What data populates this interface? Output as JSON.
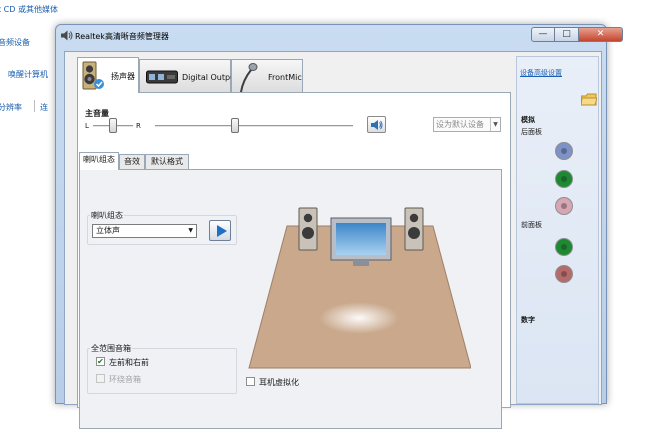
{
  "background": {
    "items": [
      "t CD 或其他媒体",
      "音频设备",
      "唤醒计算机",
      "分辨率",
      "连"
    ]
  },
  "window": {
    "title": "Realtek高清晰音频管理器",
    "buttons": {
      "minimize": "—",
      "maximize": "□",
      "close": "✕"
    }
  },
  "device_tabs": [
    {
      "label": "扬声器",
      "active": true
    },
    {
      "label": "Digital Output",
      "active": false
    },
    {
      "label": "FrontMic",
      "active": false
    }
  ],
  "volume": {
    "label": "主音量",
    "left": "L",
    "right": "R",
    "default_device": "设为默认设备"
  },
  "sub_tabs": [
    {
      "label": "喇叭组态",
      "active": true
    },
    {
      "label": "音效",
      "active": false
    },
    {
      "label": "默认格式",
      "active": false
    }
  ],
  "speaker_config": {
    "label": "喇叭组态",
    "selected": "立体声"
  },
  "fullrange": {
    "label": "全范围音箱",
    "options": [
      {
        "label": "左前和右前",
        "checked": true,
        "enabled": true
      },
      {
        "label": "环绕音箱",
        "checked": false,
        "enabled": false
      }
    ]
  },
  "headphone_virtualization": {
    "label": "耳机虚拟化",
    "checked": false
  },
  "right_panel": {
    "advanced_link": "设备高级设置",
    "analog": "模拟",
    "back_panel": "后面板",
    "front_panel": "前面板",
    "digital": "数字"
  },
  "colors": {
    "jack_blue": "#7d93c7",
    "jack_green": "#1d8a32",
    "jack_pink": "#d7a6b4",
    "jack_front_green": "#1d8a32",
    "jack_front_pink": "#b66b6b",
    "floor": "#c9a88c"
  }
}
